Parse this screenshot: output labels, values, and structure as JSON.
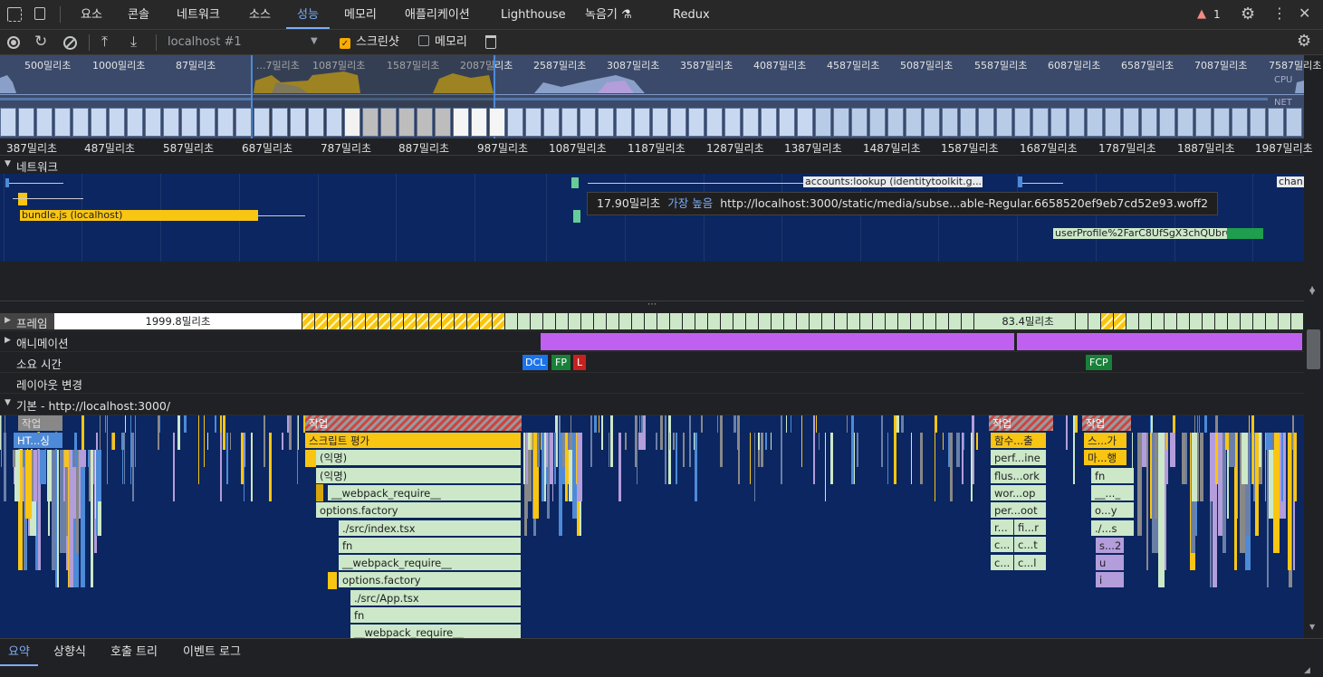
{
  "tabs": [
    "요소",
    "콘솔",
    "네트워크",
    "소스",
    "성능",
    "메모리",
    "애플리케이션",
    "Lighthouse",
    "녹음기 ⚗",
    "Redux"
  ],
  "active_tab": "성능",
  "issues_count": "1",
  "toolbar": {
    "target": "localhost #1",
    "screenshot_label": "스크린샷",
    "memory_label": "메모리"
  },
  "overview": {
    "labels": [
      "500밀리초",
      "1000밀리초",
      "87밀리초",
      "...7밀리초",
      "1087밀리초",
      "1587밀리초",
      "2087밀리초",
      "2587밀리초",
      "3087밀리초",
      "3587밀리초",
      "4087밀리초",
      "4587밀리초",
      "5087밀리초",
      "5587밀리초",
      "6087밀리초",
      "6587밀리초",
      "7087밀리초",
      "7587밀리초"
    ],
    "cpu_label": "CPU",
    "net_label": "NET"
  },
  "ruler": [
    "387밀리초",
    "487밀리초",
    "587밀리초",
    "687밀리초",
    "787밀리초",
    "887밀리초",
    "987밀리초",
    "1087밀리초",
    "1187밀리초",
    "1287밀리초",
    "1387밀리초",
    "1487밀리초",
    "1587밀리초",
    "1687밀리초",
    "1787밀리초",
    "1887밀리초",
    "1987밀리초"
  ],
  "network": {
    "title": "네트워크",
    "requests": {
      "bundle": "bundle.js (localhost)",
      "accounts": "accounts:lookup (identitytoolkit.g...",
      "userprofile": "userProfile%2FarC8UfSgX3chQUbrQ1K...",
      "chan": "chan"
    },
    "tooltip": {
      "duration": "17.90밀리초",
      "priority": "가장 높음",
      "url": "http://localhost:3000/static/media/subse...able-Regular.6658520ef9eb7cd52e93.woff2"
    }
  },
  "tracks": {
    "frames": "프레임",
    "frame_time_1": "1999.8밀리초",
    "frame_time_2": "83.4밀리초",
    "animation": "애니메이션",
    "timings": "소요 시간",
    "markers": [
      "DCL",
      "FP",
      "L",
      "FCP"
    ],
    "layout_shift": "레이아웃 변경",
    "main": "기본 - http://localhost:3000/"
  },
  "flame": {
    "task": "작업",
    "col1": [
      "HT...싱"
    ],
    "col2": [
      "스크립트 평가",
      "(익명)",
      "(익명)",
      "__webpack_require__",
      "options.factory",
      "./src/index.tsx",
      "fn",
      "__webpack_require__",
      "options.factory",
      "./src/App.tsx",
      "fn",
      "__webpack_require__"
    ],
    "col3": [
      "함수...출",
      "perf...ine",
      "flus...ork",
      "wor...op",
      "per...oot"
    ],
    "col3b": [
      "r...",
      "c...",
      "c..."
    ],
    "col3c": [
      "fi...r",
      "c...t",
      "c...l"
    ],
    "col4": [
      "스...가",
      "마...행",
      "fn",
      "__..._",
      "o...y",
      "./...s",
      "s...2",
      "u",
      "i"
    ]
  },
  "bottom_tabs": [
    "요약",
    "상향식",
    "호출 트리",
    "이벤트 로그"
  ],
  "active_bottom_tab": "요약",
  "colors": {
    "accent": "#7cacf8",
    "script": "#f9c513",
    "idle": "#0b2660",
    "js": "#cce8c8",
    "paint": "#b39ddb",
    "animation": "#c060f0"
  }
}
